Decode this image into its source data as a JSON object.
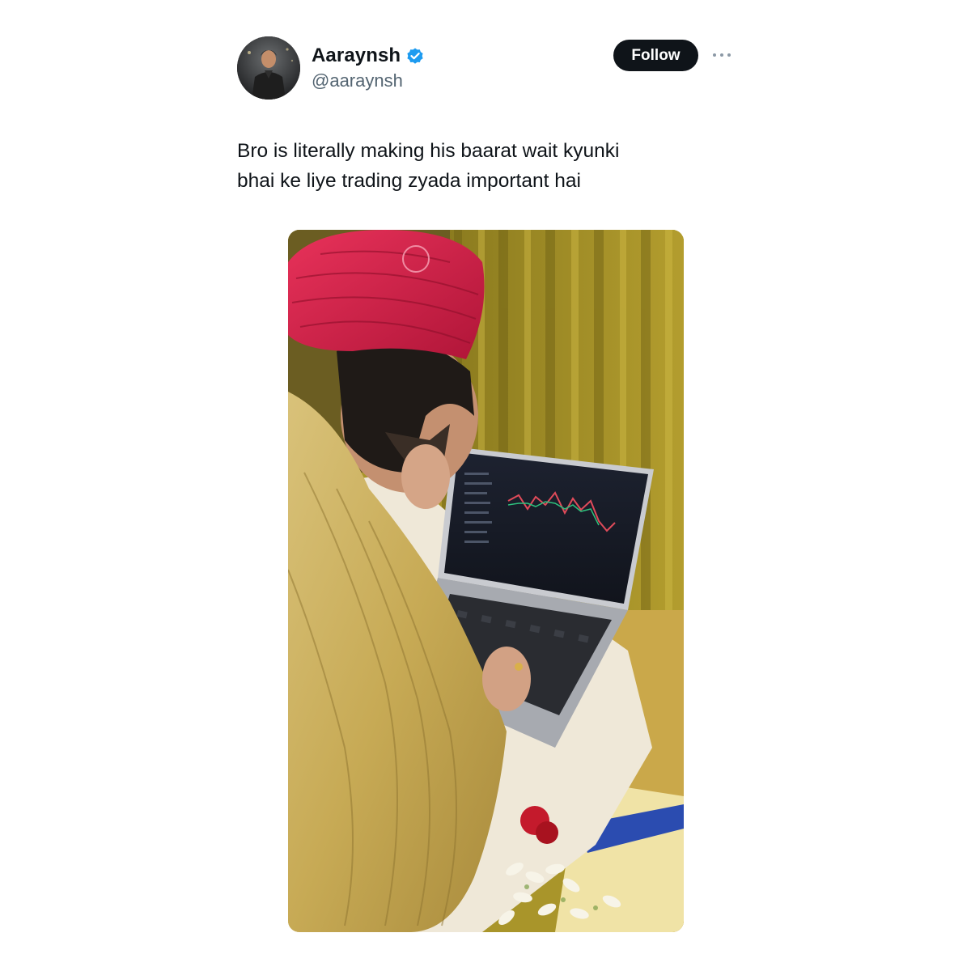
{
  "tweet": {
    "author": {
      "display_name": "Aaraynsh",
      "handle": "@aaraynsh",
      "verified": true,
      "verified_icon": "verified-badge-icon",
      "verified_color": "#1d9bf0"
    },
    "follow_label": "Follow",
    "more_icon": "more-options-icon",
    "text_lines": [
      "Bro is literally making his baarat wait kyunki",
      "bhai ke liye trading zyada important hai"
    ]
  },
  "colors": {
    "text_primary": "#0f1419",
    "text_secondary": "#536471",
    "follow_button_bg": "#0f1419"
  }
}
